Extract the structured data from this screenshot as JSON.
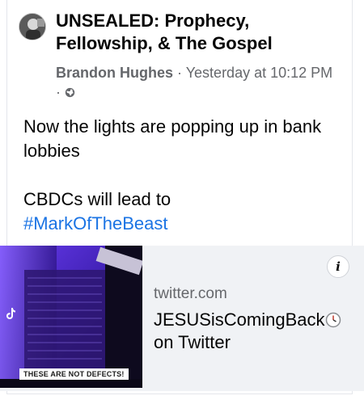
{
  "post": {
    "group_name": "UNSEALED: Prophecy, Fellowship, & The Gospel",
    "author": "Brandon Hughes",
    "separator": " · ",
    "timestamp": "Yesterday at 10:12 PM",
    "privacy_icon": "globe-icon",
    "body_line1": "Now the lights are popping up in bank lobbies",
    "body_line2": "CBDCs will lead to",
    "hashtag": "#MarkOfTheBeast"
  },
  "link_preview": {
    "domain": "twitter.com",
    "title": "JESUSisComingBack",
    "title_suffix": "on Twitter",
    "thumbnail_caption": "THESE ARE NOT DEFECTS!",
    "info_label": "i"
  },
  "colors": {
    "hashtag": "#1b74e4",
    "meta_text": "#65676b",
    "preview_bg": "#f0f2f5"
  }
}
